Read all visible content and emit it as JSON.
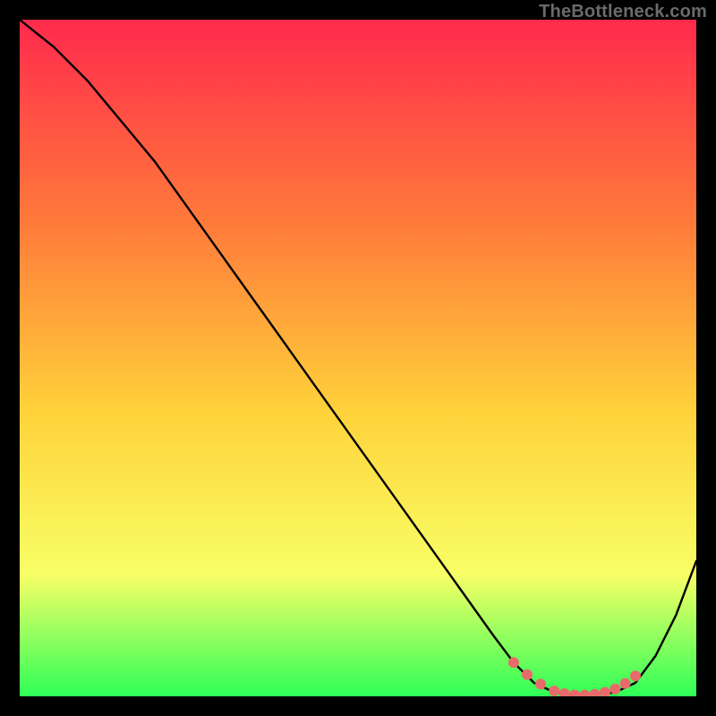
{
  "attribution": "TheBottleneck.com",
  "colors": {
    "bg": "#000000",
    "grad_top": "#ff2a4d",
    "grad_mid1": "#ff7a3a",
    "grad_mid2": "#ffd23a",
    "grad_mid3": "#f8ff66",
    "grad_bottom": "#2fff57",
    "curve": "#000000",
    "marker": "#e96a6a"
  },
  "chart_data": {
    "type": "line",
    "title": "",
    "xlabel": "",
    "ylabel": "",
    "xlim": [
      0,
      100
    ],
    "ylim": [
      0,
      100
    ],
    "series": [
      {
        "name": "bottleneck-curve",
        "x": [
          0,
          5,
          10,
          15,
          20,
          25,
          30,
          35,
          40,
          45,
          50,
          55,
          60,
          65,
          70,
          73,
          76,
          79,
          82,
          85,
          88,
          91,
          94,
          97,
          100
        ],
        "y": [
          100,
          96,
          91,
          85,
          79,
          72,
          65,
          58,
          51,
          44,
          37,
          30,
          23,
          16,
          9,
          5,
          2,
          0.6,
          0.2,
          0.2,
          0.6,
          2,
          6,
          12,
          20
        ]
      }
    ],
    "markers": {
      "name": "optimal-range",
      "x": [
        73,
        75,
        77,
        79,
        80.5,
        82,
        83.5,
        85,
        86.5,
        88,
        89.5,
        91
      ],
      "y": [
        5,
        3.2,
        1.8,
        0.8,
        0.4,
        0.2,
        0.2,
        0.3,
        0.6,
        1.1,
        1.9,
        3
      ]
    }
  }
}
